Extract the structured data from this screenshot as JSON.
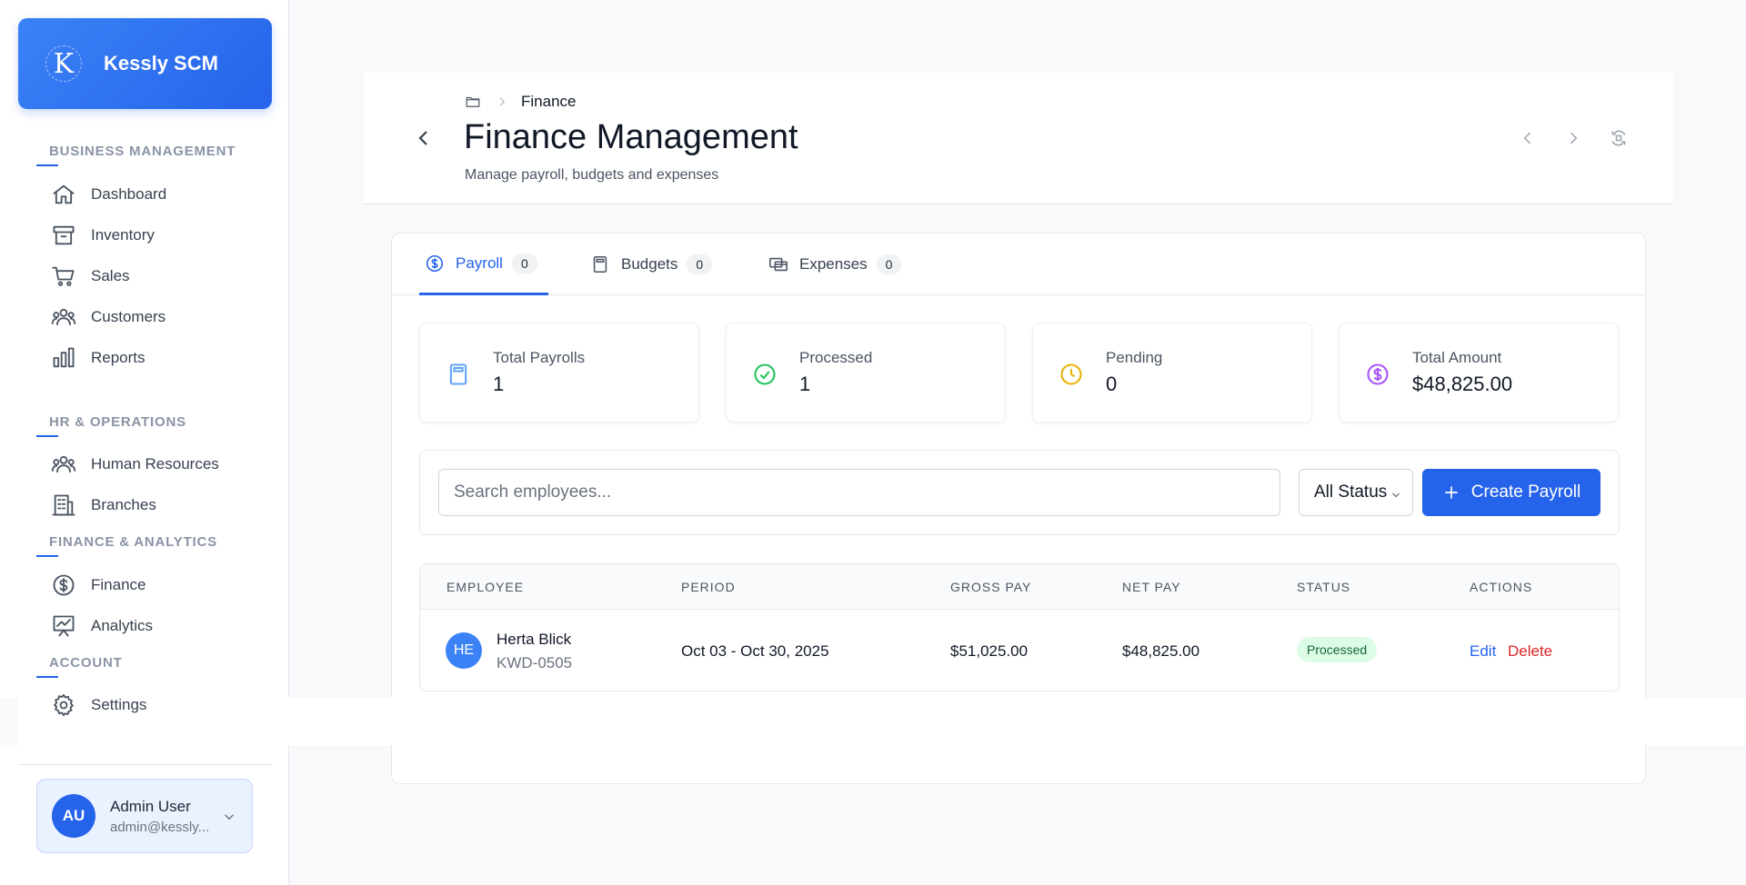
{
  "sidebar": {
    "brand": "Kessly SCM",
    "brand_logo_letter": "K",
    "sections": [
      {
        "label": "Business Management"
      },
      {
        "label": "HR & Operations"
      },
      {
        "label": "Finance & Analytics"
      },
      {
        "label": "Account"
      }
    ],
    "items": [
      {
        "label": "Dashboard",
        "icon": "home-icon"
      },
      {
        "label": "Inventory",
        "icon": "archive-icon"
      },
      {
        "label": "Sales",
        "icon": "cart-icon"
      },
      {
        "label": "Customers",
        "icon": "users-icon"
      },
      {
        "label": "Reports",
        "icon": "bar-chart-icon"
      },
      {
        "label": "Human Resources",
        "icon": "users-icon"
      },
      {
        "label": "Branches",
        "icon": "building-icon"
      },
      {
        "label": "Finance",
        "icon": "dollar-circle-icon"
      },
      {
        "label": "Analytics",
        "icon": "presentation-chart-icon"
      },
      {
        "label": "Settings",
        "icon": "gear-icon"
      }
    ],
    "user": {
      "initials": "AU",
      "name": "Admin User",
      "email": "admin@kessly..."
    }
  },
  "header": {
    "breadcrumb": "Finance",
    "title": "Finance Management",
    "subtitle": "Manage payroll, budgets and expenses"
  },
  "tabs": [
    {
      "label": "Payroll",
      "count": "0",
      "active": true
    },
    {
      "label": "Budgets",
      "count": "0",
      "active": false
    },
    {
      "label": "Expenses",
      "count": "0",
      "active": false
    }
  ],
  "stats": [
    {
      "label": "Total Payrolls",
      "value": "1",
      "color": "#60a5fa"
    },
    {
      "label": "Processed",
      "value": "1",
      "color": "#22c55e"
    },
    {
      "label": "Pending",
      "value": "0",
      "color": "#eab308"
    },
    {
      "label": "Total Amount",
      "value": "$48,825.00",
      "color": "#a855f7"
    }
  ],
  "filters": {
    "search_placeholder": "Search employees...",
    "status_value": "All Status",
    "create_label": "Create Payroll"
  },
  "table": {
    "headers": [
      "Employee",
      "Period",
      "Gross Pay",
      "Net Pay",
      "Status",
      "Actions"
    ],
    "rows": [
      {
        "initials": "HE",
        "name": "Herta Blick",
        "id": "KWD-0505",
        "period": "Oct 03 - Oct 30, 2025",
        "gross": "$51,025.00",
        "net": "$48,825.00",
        "status": "Processed",
        "edit": "Edit",
        "delete": "Delete"
      }
    ]
  },
  "colors": {
    "accent": "#2563eb",
    "danger": "#dc2626",
    "success_bg": "#dcfce7",
    "success_text": "#166534"
  }
}
